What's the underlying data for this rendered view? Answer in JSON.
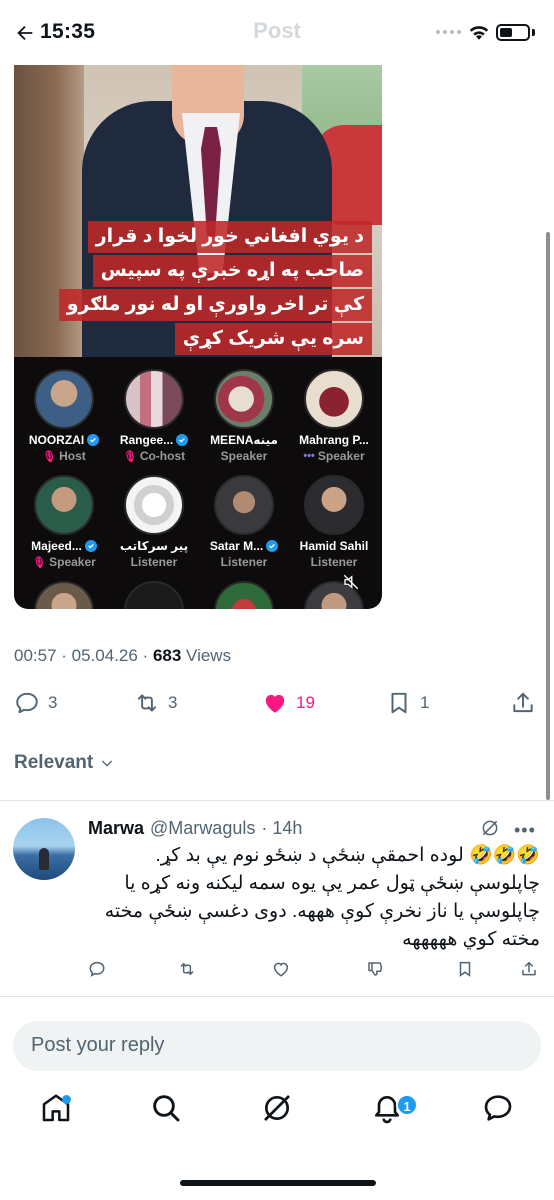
{
  "status_bar": {
    "time": "15:35"
  },
  "header": {
    "title": "Post"
  },
  "media": {
    "caption_lines": [
      "د یوي افغاني خور لخوا د قرار",
      "صاحب په اړه خبرې په سپیس",
      "کې تر اخر واورې او له نور ملګرو",
      "سره یې شریک کړې"
    ],
    "speakers": [
      {
        "name": "NOORZAI",
        "role": "Host",
        "verified": true,
        "role_icon": "mic"
      },
      {
        "name": "Rangee...",
        "role": "Co-host",
        "verified": true,
        "role_icon": "mic"
      },
      {
        "name": "MEENAمینه",
        "role": "Speaker",
        "verified": false,
        "role_icon": ""
      },
      {
        "name": "Mahrang P...",
        "role": "Speaker",
        "verified": false,
        "role_icon": "dots"
      },
      {
        "name": "Majeed...",
        "role": "Speaker",
        "verified": true,
        "role_icon": "mic"
      },
      {
        "name": "پیر سرکاتب",
        "role": "Listener",
        "verified": false,
        "role_icon": ""
      },
      {
        "name": "Satar M...",
        "role": "Listener",
        "verified": true,
        "role_icon": ""
      },
      {
        "name": "Hamid Sahil",
        "role": "Listener",
        "verified": false,
        "role_icon": ""
      }
    ]
  },
  "meta": {
    "time_date": "00:57 · 05.04.26 · ",
    "views_count": "683",
    "views_label": " Views"
  },
  "actions": {
    "replies": "3",
    "reposts": "3",
    "likes": "19",
    "bookmarks": "1"
  },
  "sort": {
    "label": "Relevant"
  },
  "reply": {
    "name": "Marwa",
    "handle": "@Marwaguls",
    "time": "· 14h",
    "text": "🤣🤣🤣 لوده احمقې ښځې د ښځو نوم یې بد کړ. چاپلوسې ښځې ټول عمر یې یوه سمه لیکنه ونه کړه یا چاپلوسې یا ناز نخرې کوې هههه. دوی دغسې ښځې مخته مخته کوي هههههه"
  },
  "composer": {
    "placeholder": "Post your reply"
  },
  "tabbar": {
    "notification_badge": "1"
  },
  "colors": {
    "accent": "#1d9bf0",
    "like": "#f91880",
    "text_secondary": "#536471"
  }
}
